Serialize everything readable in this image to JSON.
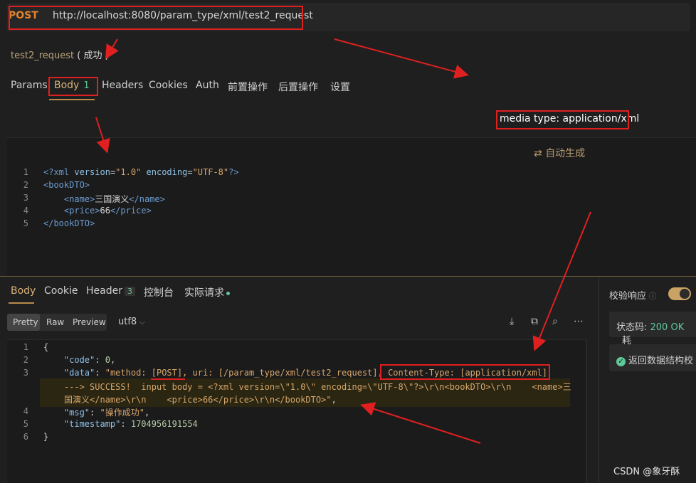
{
  "request": {
    "method": "POST",
    "url": "http://localhost:8080/param_type/xml/test2_request",
    "name": "test2_request",
    "status": "( 成功 )"
  },
  "request_tabs": {
    "params": "Params",
    "body": "Body",
    "body_badge": "1",
    "headers": "Headers",
    "cookies": "Cookies",
    "auth": "Auth",
    "pre": "前置操作",
    "post": "后置操作",
    "settings": "设置"
  },
  "body_editor": {
    "media_type": "media type: application/xml",
    "auto_generate": "自动生成",
    "lines": [
      "1",
      "2",
      "3",
      "4",
      "5"
    ],
    "xml_decl": {
      "open": "<?xml ",
      "a1": "version",
      "v1": "\"1.0\"",
      "a2": " encoding",
      "v2": "\"UTF-8\"",
      "close": "?>"
    },
    "root_open": "<bookDTO>",
    "name_open": "<name>",
    "name_value": "三国演义",
    "name_close": "</name>",
    "price_open": "<price>",
    "price_value": "66",
    "price_close": "</price>",
    "root_close": "</bookDTO>"
  },
  "response_tabs": {
    "body": "Body",
    "cookie": "Cookie",
    "header": "Header",
    "header_badge": "3",
    "console": "控制台",
    "actual": "实际请求"
  },
  "response_toolbar": {
    "pretty": "Pretty",
    "raw": "Raw",
    "preview": "Preview",
    "encoding": "utf8"
  },
  "response_body": {
    "lines": [
      "1",
      "2",
      "3",
      "",
      "",
      "4",
      "5",
      "6"
    ],
    "open_brace": "{",
    "code_key": "\"code\"",
    "code_value": "0",
    "data_key": "\"data\"",
    "data_value_1": "\"method: [POST], uri: [/param_type/xml/test2_request], Content-Type: [application/xml]",
    "data_value_2": "---> SUCCESS!  input body = <?xml version=\\\"1.0\\\" encoding=\\\"UTF-8\\\"?>\\r\\n<bookDTO>\\r\\n    <name>三",
    "data_value_3": "国演义</name>\\r\\n    <price>66</price>\\r\\n</bookDTO>\"",
    "msg_key": "\"msg\"",
    "msg_value": "\"操作成功\"",
    "timestamp_key": "\"timestamp\"",
    "timestamp_value": "1704956191554",
    "close_brace": "}"
  },
  "right_panel": {
    "verify_label": "校验响应",
    "status_label": "状态码: ",
    "status_value": "200 OK",
    "status_suffix": "耗",
    "check_label": "返回数据结构校"
  },
  "watermark": "CSDN @象牙酥",
  "colors": {
    "accent": "#c9a264",
    "annotation": "#e02020",
    "success": "#5ec99a",
    "method": "#e0832f"
  }
}
